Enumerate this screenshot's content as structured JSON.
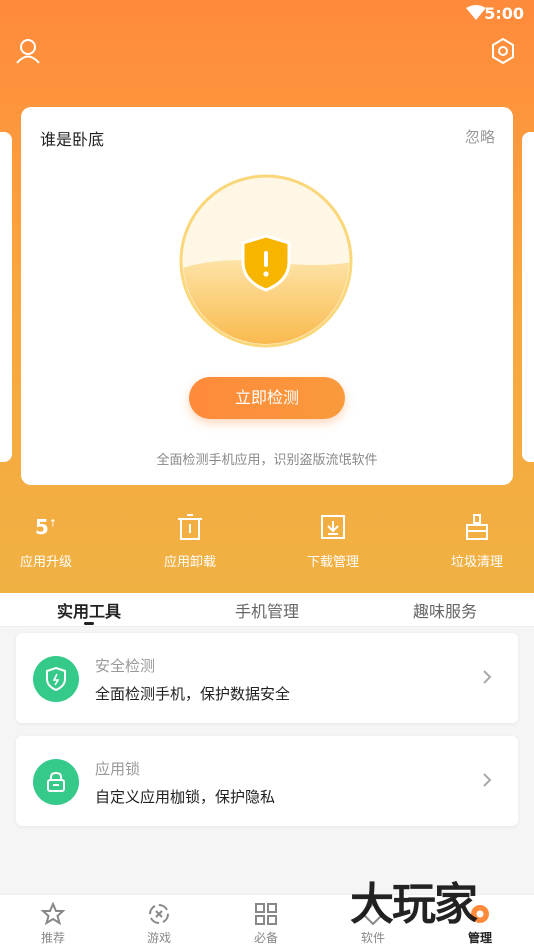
{
  "status_bar": {
    "time": "5:00"
  },
  "detection_card": {
    "title": "谁是卧底",
    "ignore_label": "忽略",
    "button_label": "立即检测",
    "description": "全面检测手机应用，识别盗版流氓软件"
  },
  "quick_actions": [
    {
      "label": "应用升级",
      "count": "5",
      "count_suffix": "↑"
    },
    {
      "label": "应用卸载"
    },
    {
      "label": "下载管理"
    },
    {
      "label": "垃圾清理"
    }
  ],
  "tabs": [
    {
      "label": "实用工具",
      "active": true
    },
    {
      "label": "手机管理",
      "active": false
    },
    {
      "label": "趣味服务",
      "active": false
    }
  ],
  "tools": [
    {
      "title": "安全检测",
      "description": "全面检测手机，保护数据安全",
      "icon": "shield-icon"
    },
    {
      "title": "应用锁",
      "description": "自定义应用枷锁，保护隐私",
      "icon": "lock-icon"
    }
  ],
  "bottom_nav": [
    {
      "label": "推荐",
      "icon": "star-icon",
      "active": false
    },
    {
      "label": "游戏",
      "icon": "gamepad-icon",
      "active": false
    },
    {
      "label": "必备",
      "icon": "grid-icon",
      "active": false
    },
    {
      "label": "软件",
      "icon": "apps-icon",
      "active": false
    },
    {
      "label": "管理",
      "icon": "manage-icon",
      "active": true
    }
  ],
  "watermark": "大玩家",
  "colors": {
    "accent": "#fe8a3b",
    "hero_gradient_end": "#f0b143",
    "tool_icon_bg": "#35c98a",
    "shield": "#f7b500"
  }
}
